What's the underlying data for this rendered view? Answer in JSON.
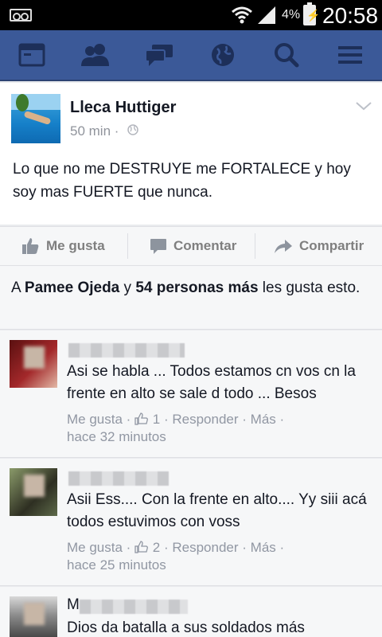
{
  "status_bar": {
    "battery_percent": "4%",
    "time": "20:58",
    "icons": [
      "voicemail-icon",
      "wifi-icon",
      "signal-icon",
      "battery-charging-icon"
    ]
  },
  "navbar": {
    "brand_color": "#3b5998",
    "items": [
      "news-feed-icon",
      "friend-requests-icon",
      "messages-icon",
      "notifications-globe-icon",
      "search-icon",
      "menu-icon"
    ]
  },
  "post": {
    "author": "Lleca Huttiger",
    "time": "50 min ·",
    "text": "Lo que no me DESTRUYE me FORTALECE y hoy soy mas FUERTE que nunca."
  },
  "actions": {
    "like": "Me gusta",
    "comment": "Comentar",
    "share": "Compartir"
  },
  "likes_summary": {
    "prefix": "A ",
    "name": "Pamee Ojeda",
    "middle": " y ",
    "others": "54 personas más",
    "suffix": " les gusta esto."
  },
  "comments": [
    {
      "text": "Asi se habla ... Todos estamos cn vos cn la frente en alto se sale d todo ... Besos",
      "like_label": "Me gusta ·",
      "like_count": "1",
      "reply_label": "· Responder ·",
      "more_label": "Más ·",
      "time": "hace 32 minutos"
    },
    {
      "text": "Asii Ess.... Con la frente en alto.... Yy siii acá todos estuvimos con voss",
      "like_label": "Me gusta ·",
      "like_count": "2",
      "reply_label": "· Responder ·",
      "more_label": "Más ·",
      "time": "hace 25 minutos"
    },
    {
      "initial": "M",
      "text": "Dios da batalla a sus soldados más"
    }
  ]
}
